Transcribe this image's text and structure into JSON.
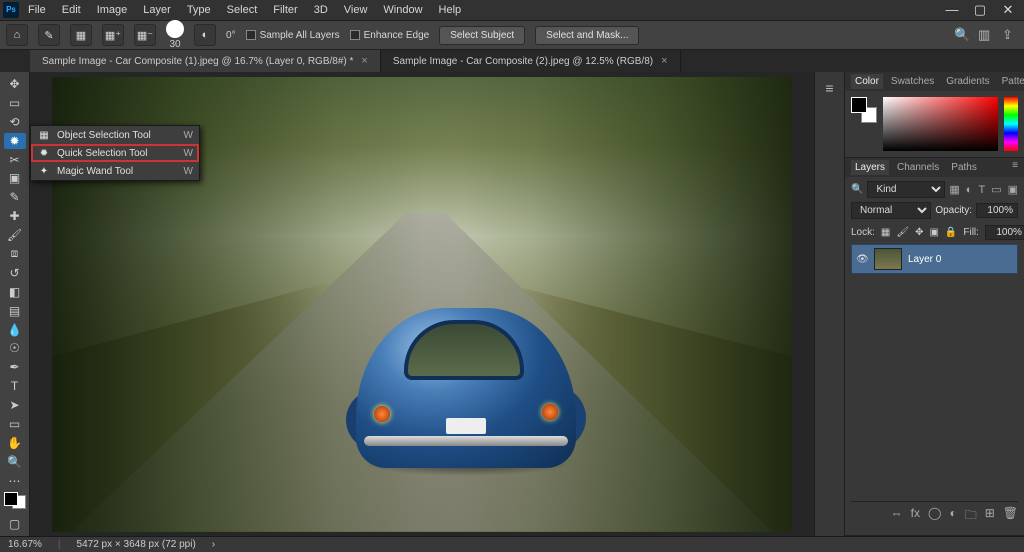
{
  "menubar": {
    "items": [
      "File",
      "Edit",
      "Image",
      "Layer",
      "Type",
      "Select",
      "Filter",
      "3D",
      "View",
      "Window",
      "Help"
    ]
  },
  "optionsbar": {
    "brush_size": "30",
    "angle_label": "0°",
    "sample_all": "Sample All Layers",
    "enhance_edge": "Enhance Edge",
    "select_subject": "Select Subject",
    "select_and_mask": "Select and Mask..."
  },
  "tabs": [
    {
      "label": "Sample Image - Car Composite (1).jpeg @ 16.7% (Layer 0, RGB/8#) *",
      "active": true
    },
    {
      "label": "Sample Image - Car Composite (2).jpeg @ 12.5% (RGB/8)",
      "active": false
    }
  ],
  "flyout": {
    "shortcut": "W",
    "items": [
      {
        "label": "Object Selection Tool",
        "highlighted": false
      },
      {
        "label": "Quick Selection Tool",
        "highlighted": true
      },
      {
        "label": "Magic Wand Tool",
        "highlighted": false
      }
    ]
  },
  "color_panel": {
    "tabs": [
      "Color",
      "Swatches",
      "Gradients",
      "Patterns"
    ]
  },
  "layers_panel": {
    "tabs": [
      "Layers",
      "Channels",
      "Paths"
    ],
    "filter_label": "Kind",
    "blend_mode": "Normal",
    "opacity_label": "Opacity:",
    "opacity_value": "100%",
    "lock_label": "Lock:",
    "fill_label": "Fill:",
    "fill_value": "100%",
    "layer0": "Layer 0"
  },
  "statusbar": {
    "zoom": "16.67%",
    "dims": "5472 px × 3648 px (72 ppi)"
  }
}
